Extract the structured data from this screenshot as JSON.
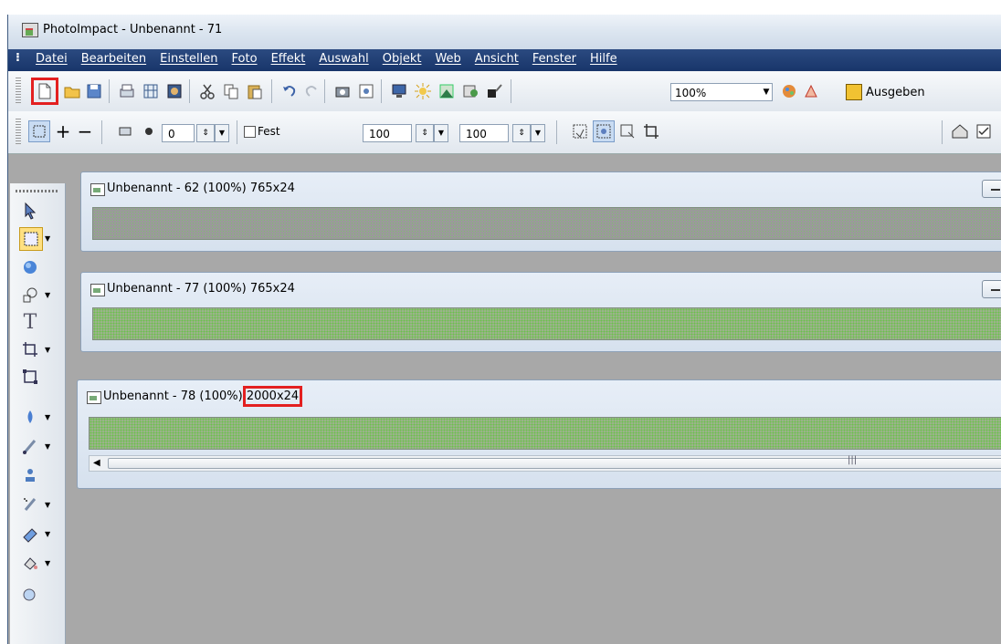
{
  "window": {
    "title": "PhotoImpact - Unbenannt - 71"
  },
  "menu": [
    "Datei",
    "Bearbeiten",
    "Einstellen",
    "Foto",
    "Effekt",
    "Auswahl",
    "Objekt",
    "Web",
    "Ansicht",
    "Fenster",
    "Hilfe"
  ],
  "toolbar": {
    "zoom_value": "100%",
    "output_label": "Ausgeben",
    "icons": [
      "new-icon",
      "open-icon",
      "save-icon",
      "scan-icon",
      "grid-icon",
      "capture-icon",
      "cut-icon",
      "copy-icon",
      "paste-icon",
      "undo-icon",
      "redo-icon",
      "camera-icon",
      "preview-icon",
      "monitor-icon",
      "sun-icon",
      "image-icon",
      "effect-icon",
      "paint-icon"
    ]
  },
  "attributes": {
    "feather_value": "0",
    "fixed_label": "Fest",
    "width_value": "100",
    "height_value": "100"
  },
  "documents": [
    {
      "title": "Unbenannt - 62 (100%) 765x24",
      "name_part": "Unbenannt - 62 (100%) ",
      "size_part": "765x24"
    },
    {
      "title": "Unbenannt - 77 (100%) 765x24",
      "name_part": "Unbenannt - 77 (100%) ",
      "size_part": "765x24"
    },
    {
      "title": "Unbenannt - 78 (100%) 2000x24",
      "name_part": "Unbenannt - 78 (100%) ",
      "size_part": "2000x24"
    }
  ],
  "colors": {
    "highlight": "#e32020",
    "menubar": "#1d3a70",
    "workspace": "#a8a8a8",
    "canvas_green": "#6ac24a"
  }
}
